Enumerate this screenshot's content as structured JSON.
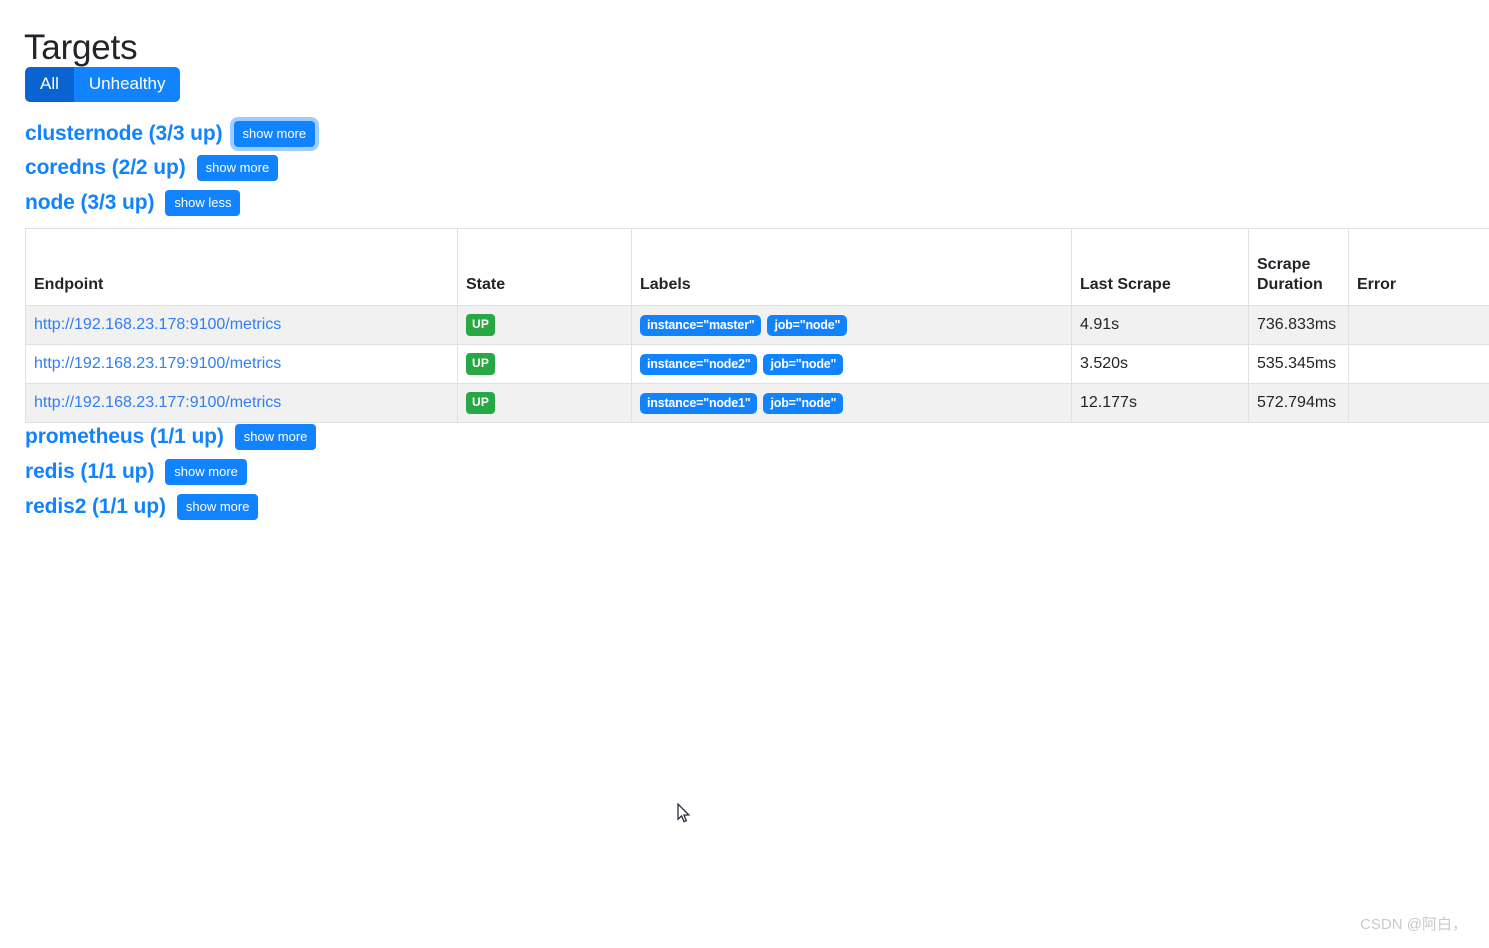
{
  "page": {
    "title": "Targets"
  },
  "filters": {
    "all_label": "All",
    "unhealthy_label": "Unhealthy",
    "active": "All",
    "active_color": "#0a63d0",
    "inactive_color": "#1283ff"
  },
  "jobs": [
    {
      "name": "clusternode",
      "up": "3/3",
      "heading": "clusternode (3/3 up)",
      "toggle_label": "show more",
      "expanded": false,
      "focused": true
    },
    {
      "name": "coredns",
      "up": "2/2",
      "heading": "coredns (2/2 up)",
      "toggle_label": "show more",
      "expanded": false,
      "focused": false
    },
    {
      "name": "node",
      "up": "3/3",
      "heading": "node (3/3 up)",
      "toggle_label": "show less",
      "expanded": true,
      "focused": false
    },
    {
      "name": "prometheus",
      "up": "1/1",
      "heading": "prometheus (1/1 up)",
      "toggle_label": "show more",
      "expanded": false,
      "focused": false
    },
    {
      "name": "redis",
      "up": "1/1",
      "heading": "redis (1/1 up)",
      "toggle_label": "show more",
      "expanded": false,
      "focused": false
    },
    {
      "name": "redis2",
      "up": "1/1",
      "heading": "redis2 (1/1 up)",
      "toggle_label": "show more",
      "expanded": false,
      "focused": false
    }
  ],
  "table": {
    "columns": [
      "Endpoint",
      "State",
      "Labels",
      "Last Scrape",
      "Scrape Duration",
      "Error"
    ],
    "rows": [
      {
        "endpoint": "http://192.168.23.178:9100/metrics",
        "state": "UP",
        "labels": [
          "instance=\"master\"",
          "job=\"node\""
        ],
        "last_scrape": "4.91s",
        "scrape_duration": "736.833ms",
        "error": ""
      },
      {
        "endpoint": "http://192.168.23.179:9100/metrics",
        "state": "UP",
        "labels": [
          "instance=\"node2\"",
          "job=\"node\""
        ],
        "last_scrape": "3.520s",
        "scrape_duration": "535.345ms",
        "error": ""
      },
      {
        "endpoint": "http://192.168.23.177:9100/metrics",
        "state": "UP",
        "labels": [
          "instance=\"node1\"",
          "job=\"node\""
        ],
        "last_scrape": "12.177s",
        "scrape_duration": "572.794ms",
        "error": ""
      }
    ],
    "state_color": "#28a745",
    "label_color": "#1283ff",
    "link_color": "#2f7ef4"
  },
  "watermark": {
    "text": "CSDN @阿白，"
  }
}
